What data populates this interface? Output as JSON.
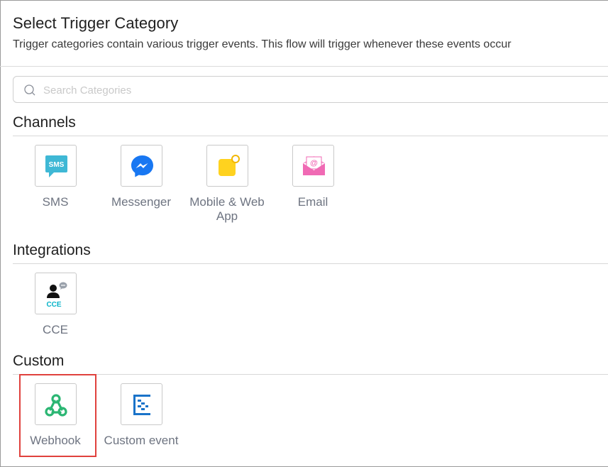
{
  "header": {
    "title": "Select Trigger Category",
    "subtitle": "Trigger categories contain various trigger events. This flow will trigger whenever these events occur"
  },
  "search": {
    "placeholder": "Search Categories",
    "value": ""
  },
  "sections": {
    "channels": {
      "title": "Channels",
      "items": [
        {
          "label": "SMS",
          "icon": "sms-icon",
          "icon_text": "SMS"
        },
        {
          "label": "Messenger",
          "icon": "messenger-icon"
        },
        {
          "label": "Mobile & Web App",
          "icon": "mobile-web-app-icon"
        },
        {
          "label": "Email",
          "icon": "email-icon",
          "icon_text": "@"
        }
      ]
    },
    "integrations": {
      "title": "Integrations",
      "items": [
        {
          "label": "CCE",
          "icon": "cce-icon",
          "icon_text": "CCE"
        }
      ]
    },
    "custom": {
      "title": "Custom",
      "items": [
        {
          "label": "Webhook",
          "icon": "webhook-icon",
          "highlighted": true
        },
        {
          "label": "Custom event",
          "icon": "custom-event-icon"
        }
      ]
    }
  },
  "colors": {
    "sms": "#3fb8d5",
    "messenger": "#1877f2",
    "mobile_app": "#ffd21f",
    "email": "#f06ab4",
    "cce": "#07b3c8",
    "webhook": "#2bb673",
    "custom_event": "#1a73c9",
    "highlight": "#e0413d"
  }
}
